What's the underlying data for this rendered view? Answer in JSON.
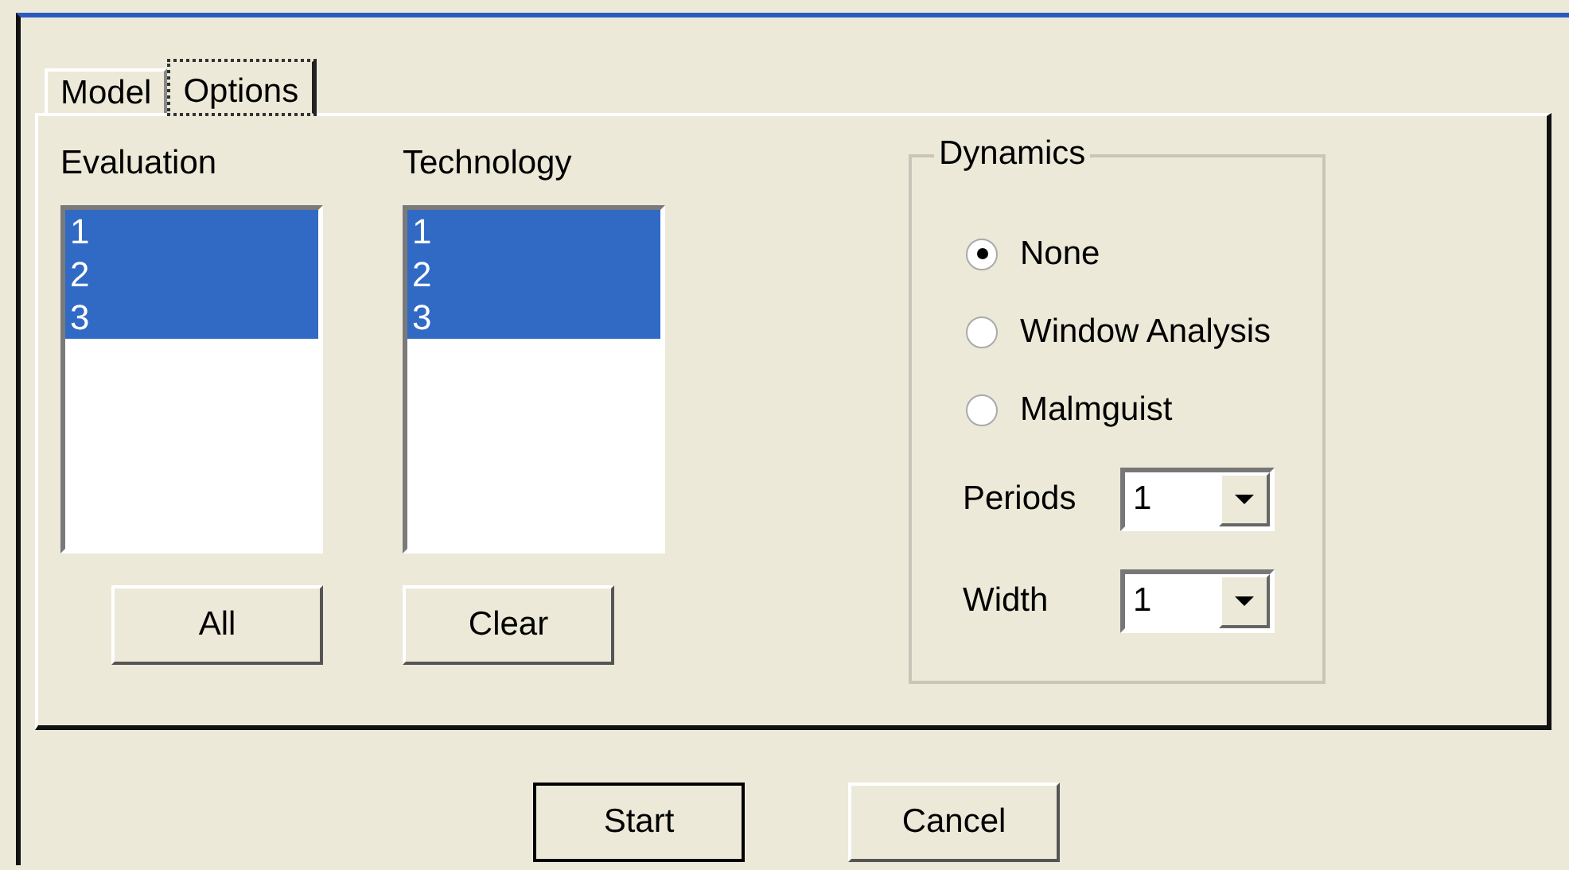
{
  "tabs": [
    {
      "label": "Model",
      "selected": false
    },
    {
      "label": "Options",
      "selected": true
    }
  ],
  "lists": [
    {
      "label": "Evaluation",
      "items": [
        {
          "text": "1",
          "selected": true
        },
        {
          "text": "2",
          "selected": true
        },
        {
          "text": "3",
          "selected": true
        }
      ]
    },
    {
      "label": "Technology",
      "items": [
        {
          "text": "1",
          "selected": true
        },
        {
          "text": "2",
          "selected": true
        },
        {
          "text": "3",
          "selected": true
        }
      ]
    }
  ],
  "list_buttons": [
    "All",
    "Clear"
  ],
  "dynamics": {
    "title": "Dynamics",
    "options": [
      {
        "label": "None",
        "selected": true
      },
      {
        "label": "Window Analysis",
        "selected": false
      },
      {
        "label": "Malmguist",
        "selected": false
      }
    ],
    "fields": [
      {
        "label": "Periods",
        "value": "1"
      },
      {
        "label": "Width",
        "value": "1"
      }
    ]
  },
  "buttons": [
    {
      "label": "Start",
      "default": true
    },
    {
      "label": "Cancel",
      "default": false
    }
  ]
}
